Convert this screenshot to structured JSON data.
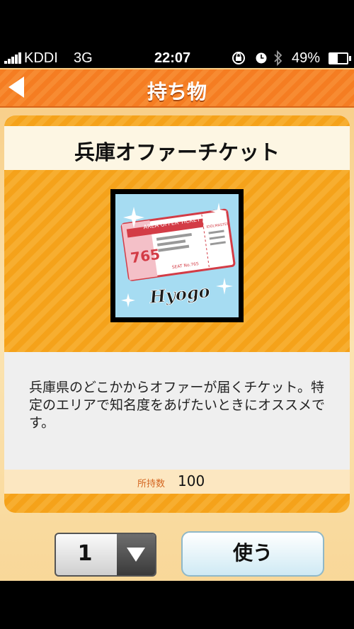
{
  "status_bar": {
    "carrier": "KDDI",
    "network": "3G",
    "time": "22:07",
    "battery": "49%"
  },
  "header": {
    "title": "持ち物"
  },
  "item": {
    "name": "兵庫オファーチケット",
    "image": {
      "ticket_header": "AREA OFFER TICKET",
      "ticket_number": "765",
      "seat": "SEAT No.765",
      "side_label": "IDOLMASTER",
      "script_text": "Hyogo"
    },
    "description": "兵庫県のどこかからオファーが届くチケット。特定のエリアで知名度をあげたいときにオススメです。",
    "count_label": "所持数",
    "count_value": "100"
  },
  "controls": {
    "quantity": "1",
    "use_label": "使う"
  },
  "colors": {
    "header_orange": "#f57d22",
    "card_orange": "#f5a21a",
    "image_bg": "#a6dcf2"
  }
}
